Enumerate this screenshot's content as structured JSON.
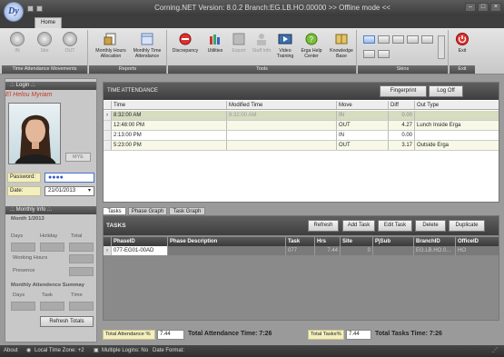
{
  "app": {
    "title": "Corning.NET Version: 8.0.2 Branch:EG.LB.HO.00000 >> Offline mode <<",
    "logo_text": "Dy"
  },
  "tabs": {
    "home": "Home"
  },
  "ribbon": {
    "groups": {
      "attendance": "Time Attendance Movements",
      "reports": "Reports",
      "tools": "Tools",
      "skins": "Skins",
      "exit": "Exit"
    },
    "buttons": {
      "in": "IN",
      "site": "Site",
      "out": "OUT",
      "monthly_hours": "Monthly Hours Allocation",
      "monthly_time": "Monthly Time Attendance",
      "discrepancy": "Discrepancy",
      "utilities": "Utilities",
      "export": "Export",
      "staff_info": "Staff Info",
      "video_training": "Video Training",
      "erga_help": "Erga Help Center",
      "knowledge_base": "Knowledge Base",
      "exit": "Exit"
    }
  },
  "login": {
    "header": ".:. Login .:.",
    "user_name": "El Helou Myriam",
    "mye_button": "MYE",
    "password_label": "Password:",
    "password_value": "●●●●",
    "date_label": "Date:",
    "date_value": "21/01/2013"
  },
  "monthly": {
    "header": ".:. Monthly Info .:.",
    "month": "Month 1/2013",
    "cols": [
      "Days",
      "Holiday",
      "Total"
    ],
    "working_hours": "Working Hours",
    "presence": "Presence",
    "summary_title": "Monthly Attendence Summay",
    "summary_cols": [
      "Days",
      "Task",
      "Time"
    ],
    "refresh_button": "Refresh Totals"
  },
  "attendance": {
    "header": "TIME ATTENDANCE",
    "fingerprint_button": "Fingerprint",
    "logoff_button": "Log Off",
    "columns": [
      "Time",
      "Modified Time",
      "Move",
      "Diff",
      "Out Type"
    ],
    "rows": [
      {
        "time": "8:32:00 AM",
        "modified": "8:32:00 AM",
        "move": "IN",
        "diff": "0.00",
        "out_type": ""
      },
      {
        "time": "12:48:00 PM",
        "modified": "",
        "move": "OUT",
        "diff": "4.27",
        "out_type": "Lunch Inside Erga"
      },
      {
        "time": "2:13:00 PM",
        "modified": "",
        "move": "IN",
        "diff": "0.00",
        "out_type": ""
      },
      {
        "time": "5:23:00 PM",
        "modified": "",
        "move": "OUT",
        "diff": "3.17",
        "out_type": "Outside Erga"
      }
    ]
  },
  "subtabs": {
    "tasks": "Tasks",
    "phase_graph": "Phase Graph",
    "task_graph": "Task Graph"
  },
  "tasks": {
    "header": "TASKS",
    "buttons": {
      "refresh": "Refresh",
      "add": "Add Task",
      "edit": "Edit Task",
      "delete": "Delete",
      "duplicate": "Duplicate"
    },
    "columns": [
      "PhaseID",
      "Phase Description",
      "Task",
      "Hrs",
      "Site",
      "PjSub",
      "BranchID",
      "OfficeID"
    ],
    "rows": [
      {
        "phase_id": "077-EG01-00AD",
        "desc": "",
        "task": "077",
        "hrs": "7.44",
        "site": "0",
        "pjsub": "",
        "branch": "EG.LB.HO.0...",
        "office": "HO"
      }
    ]
  },
  "totals": {
    "attendance_pct_label": "Total Attendance %",
    "attendance_pct": "7.44",
    "attendance_time": "Total Attendance Time: 7:26",
    "tasks_pct_label": "Total Tasks%",
    "tasks_pct": "7.44",
    "tasks_time": "Total Tasks Time: 7:26"
  },
  "status": {
    "about": "About",
    "timezone": "Local Time Zone: +2",
    "logins": "Multiple Logins: No",
    "date_format": "Date Format:"
  }
}
